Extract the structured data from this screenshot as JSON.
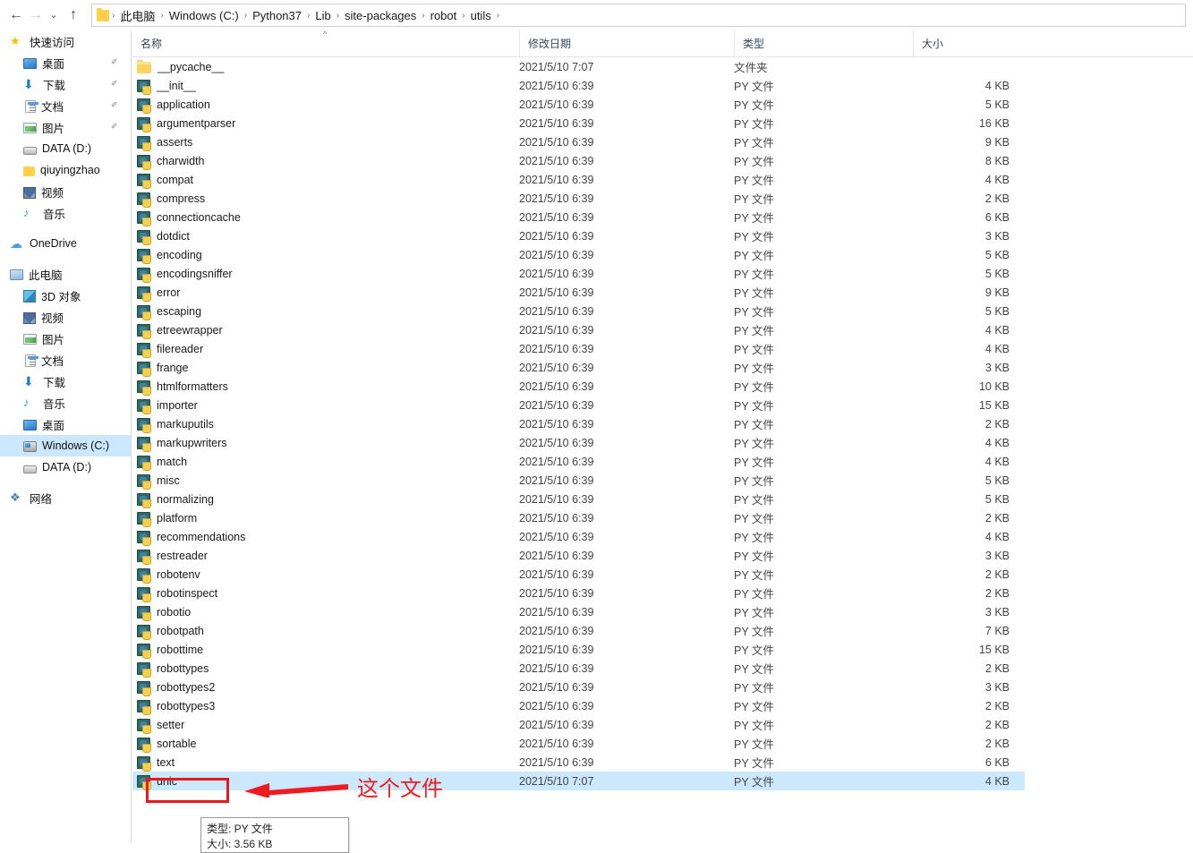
{
  "addressbar": {
    "back_icon": "←",
    "forward_icon": "→",
    "history_icon": "⌄",
    "up_icon": "↑",
    "separator": "›",
    "crumbs": [
      "此电脑",
      "Windows (C:)",
      "Python37",
      "Lib",
      "site-packages",
      "robot",
      "utils"
    ]
  },
  "sidebar": {
    "items": [
      {
        "label": "快速访问",
        "icon": "star-icon",
        "level": 0,
        "pinned": false,
        "selected": false
      },
      {
        "label": "桌面",
        "icon": "desktop-icon",
        "level": 1,
        "pinned": true,
        "selected": false
      },
      {
        "label": "下载",
        "icon": "download-icon",
        "level": 1,
        "pinned": true,
        "selected": false
      },
      {
        "label": "文档",
        "icon": "document-icon",
        "level": 1,
        "pinned": true,
        "selected": false
      },
      {
        "label": "图片",
        "icon": "pictures-icon",
        "level": 1,
        "pinned": true,
        "selected": false
      },
      {
        "label": "DATA (D:)",
        "icon": "drive-icon",
        "level": 1,
        "pinned": false,
        "selected": false
      },
      {
        "label": "qiuyingzhao",
        "icon": "folder-icon",
        "level": 1,
        "pinned": false,
        "selected": false
      },
      {
        "label": "视频",
        "icon": "video-icon",
        "level": 1,
        "pinned": false,
        "selected": false
      },
      {
        "label": "音乐",
        "icon": "music-icon",
        "level": 1,
        "pinned": false,
        "selected": false
      },
      {
        "label": "OneDrive",
        "icon": "cloud-icon",
        "level": 0,
        "pinned": false,
        "selected": false
      },
      {
        "label": "此电脑",
        "icon": "this-pc-icon",
        "level": 0,
        "pinned": false,
        "selected": false
      },
      {
        "label": "3D 对象",
        "icon": "3d-objects-icon",
        "level": 1,
        "pinned": false,
        "selected": false
      },
      {
        "label": "视频",
        "icon": "video-icon",
        "level": 1,
        "pinned": false,
        "selected": false
      },
      {
        "label": "图片",
        "icon": "pictures-icon",
        "level": 1,
        "pinned": false,
        "selected": false
      },
      {
        "label": "文档",
        "icon": "document-icon",
        "level": 1,
        "pinned": false,
        "selected": false
      },
      {
        "label": "下载",
        "icon": "download-icon",
        "level": 1,
        "pinned": false,
        "selected": false
      },
      {
        "label": "音乐",
        "icon": "music-icon",
        "level": 1,
        "pinned": false,
        "selected": false
      },
      {
        "label": "桌面",
        "icon": "desktop-icon",
        "level": 1,
        "pinned": false,
        "selected": false
      },
      {
        "label": "Windows (C:)",
        "icon": "windows-drive-icon",
        "level": 1,
        "pinned": false,
        "selected": true
      },
      {
        "label": "DATA (D:)",
        "icon": "drive-icon",
        "level": 1,
        "pinned": false,
        "selected": false
      },
      {
        "label": "网络",
        "icon": "network-icon",
        "level": 0,
        "pinned": false,
        "selected": false
      }
    ]
  },
  "filelist": {
    "columns": [
      {
        "label": "名称",
        "key": "name"
      },
      {
        "label": "修改日期",
        "key": "date"
      },
      {
        "label": "类型",
        "key": "type"
      },
      {
        "label": "大小",
        "key": "size"
      }
    ],
    "sort_caret": "^",
    "rows": [
      {
        "name": "__pycache__",
        "date": "2021/5/10 7:07",
        "type": "文件夹",
        "size": "",
        "icon": "folder-icon",
        "selected": false
      },
      {
        "name": "__init__",
        "date": "2021/5/10 6:39",
        "type": "PY 文件",
        "size": "4 KB",
        "icon": "py-file-icon",
        "selected": false
      },
      {
        "name": "application",
        "date": "2021/5/10 6:39",
        "type": "PY 文件",
        "size": "5 KB",
        "icon": "py-file-icon",
        "selected": false
      },
      {
        "name": "argumentparser",
        "date": "2021/5/10 6:39",
        "type": "PY 文件",
        "size": "16 KB",
        "icon": "py-file-icon",
        "selected": false
      },
      {
        "name": "asserts",
        "date": "2021/5/10 6:39",
        "type": "PY 文件",
        "size": "9 KB",
        "icon": "py-file-icon",
        "selected": false
      },
      {
        "name": "charwidth",
        "date": "2021/5/10 6:39",
        "type": "PY 文件",
        "size": "8 KB",
        "icon": "py-file-icon",
        "selected": false
      },
      {
        "name": "compat",
        "date": "2021/5/10 6:39",
        "type": "PY 文件",
        "size": "4 KB",
        "icon": "py-file-icon",
        "selected": false
      },
      {
        "name": "compress",
        "date": "2021/5/10 6:39",
        "type": "PY 文件",
        "size": "2 KB",
        "icon": "py-file-icon",
        "selected": false
      },
      {
        "name": "connectioncache",
        "date": "2021/5/10 6:39",
        "type": "PY 文件",
        "size": "6 KB",
        "icon": "py-file-icon",
        "selected": false
      },
      {
        "name": "dotdict",
        "date": "2021/5/10 6:39",
        "type": "PY 文件",
        "size": "3 KB",
        "icon": "py-file-icon",
        "selected": false
      },
      {
        "name": "encoding",
        "date": "2021/5/10 6:39",
        "type": "PY 文件",
        "size": "5 KB",
        "icon": "py-file-icon",
        "selected": false
      },
      {
        "name": "encodingsniffer",
        "date": "2021/5/10 6:39",
        "type": "PY 文件",
        "size": "5 KB",
        "icon": "py-file-icon",
        "selected": false
      },
      {
        "name": "error",
        "date": "2021/5/10 6:39",
        "type": "PY 文件",
        "size": "9 KB",
        "icon": "py-file-icon",
        "selected": false
      },
      {
        "name": "escaping",
        "date": "2021/5/10 6:39",
        "type": "PY 文件",
        "size": "5 KB",
        "icon": "py-file-icon",
        "selected": false
      },
      {
        "name": "etreewrapper",
        "date": "2021/5/10 6:39",
        "type": "PY 文件",
        "size": "4 KB",
        "icon": "py-file-icon",
        "selected": false
      },
      {
        "name": "filereader",
        "date": "2021/5/10 6:39",
        "type": "PY 文件",
        "size": "4 KB",
        "icon": "py-file-icon",
        "selected": false
      },
      {
        "name": "frange",
        "date": "2021/5/10 6:39",
        "type": "PY 文件",
        "size": "3 KB",
        "icon": "py-file-icon",
        "selected": false
      },
      {
        "name": "htmlformatters",
        "date": "2021/5/10 6:39",
        "type": "PY 文件",
        "size": "10 KB",
        "icon": "py-file-icon",
        "selected": false
      },
      {
        "name": "importer",
        "date": "2021/5/10 6:39",
        "type": "PY 文件",
        "size": "15 KB",
        "icon": "py-file-icon",
        "selected": false
      },
      {
        "name": "markuputils",
        "date": "2021/5/10 6:39",
        "type": "PY 文件",
        "size": "2 KB",
        "icon": "py-file-icon",
        "selected": false
      },
      {
        "name": "markupwriters",
        "date": "2021/5/10 6:39",
        "type": "PY 文件",
        "size": "4 KB",
        "icon": "py-file-icon",
        "selected": false
      },
      {
        "name": "match",
        "date": "2021/5/10 6:39",
        "type": "PY 文件",
        "size": "4 KB",
        "icon": "py-file-icon",
        "selected": false
      },
      {
        "name": "misc",
        "date": "2021/5/10 6:39",
        "type": "PY 文件",
        "size": "5 KB",
        "icon": "py-file-icon",
        "selected": false
      },
      {
        "name": "normalizing",
        "date": "2021/5/10 6:39",
        "type": "PY 文件",
        "size": "5 KB",
        "icon": "py-file-icon",
        "selected": false
      },
      {
        "name": "platform",
        "date": "2021/5/10 6:39",
        "type": "PY 文件",
        "size": "2 KB",
        "icon": "py-file-icon",
        "selected": false
      },
      {
        "name": "recommendations",
        "date": "2021/5/10 6:39",
        "type": "PY 文件",
        "size": "4 KB",
        "icon": "py-file-icon",
        "selected": false
      },
      {
        "name": "restreader",
        "date": "2021/5/10 6:39",
        "type": "PY 文件",
        "size": "3 KB",
        "icon": "py-file-icon",
        "selected": false
      },
      {
        "name": "robotenv",
        "date": "2021/5/10 6:39",
        "type": "PY 文件",
        "size": "2 KB",
        "icon": "py-file-icon",
        "selected": false
      },
      {
        "name": "robotinspect",
        "date": "2021/5/10 6:39",
        "type": "PY 文件",
        "size": "2 KB",
        "icon": "py-file-icon",
        "selected": false
      },
      {
        "name": "robotio",
        "date": "2021/5/10 6:39",
        "type": "PY 文件",
        "size": "3 KB",
        "icon": "py-file-icon",
        "selected": false
      },
      {
        "name": "robotpath",
        "date": "2021/5/10 6:39",
        "type": "PY 文件",
        "size": "7 KB",
        "icon": "py-file-icon",
        "selected": false
      },
      {
        "name": "robottime",
        "date": "2021/5/10 6:39",
        "type": "PY 文件",
        "size": "15 KB",
        "icon": "py-file-icon",
        "selected": false
      },
      {
        "name": "robottypes",
        "date": "2021/5/10 6:39",
        "type": "PY 文件",
        "size": "2 KB",
        "icon": "py-file-icon",
        "selected": false
      },
      {
        "name": "robottypes2",
        "date": "2021/5/10 6:39",
        "type": "PY 文件",
        "size": "3 KB",
        "icon": "py-file-icon",
        "selected": false
      },
      {
        "name": "robottypes3",
        "date": "2021/5/10 6:39",
        "type": "PY 文件",
        "size": "2 KB",
        "icon": "py-file-icon",
        "selected": false
      },
      {
        "name": "setter",
        "date": "2021/5/10 6:39",
        "type": "PY 文件",
        "size": "2 KB",
        "icon": "py-file-icon",
        "selected": false
      },
      {
        "name": "sortable",
        "date": "2021/5/10 6:39",
        "type": "PY 文件",
        "size": "2 KB",
        "icon": "py-file-icon",
        "selected": false
      },
      {
        "name": "text",
        "date": "2021/5/10 6:39",
        "type": "PY 文件",
        "size": "6 KB",
        "icon": "py-file-icon",
        "selected": false
      },
      {
        "name": "unic",
        "date": "2021/5/10 7:07",
        "type": "PY 文件",
        "size": "4 KB",
        "icon": "py-file-icon",
        "selected": true
      }
    ]
  },
  "tooltip": {
    "line1": "类型: PY 文件",
    "line2": "大小: 3.56 KB"
  },
  "annotation": {
    "text": "这个文件",
    "color": "#f01c1c",
    "arrow_direction": "left"
  }
}
